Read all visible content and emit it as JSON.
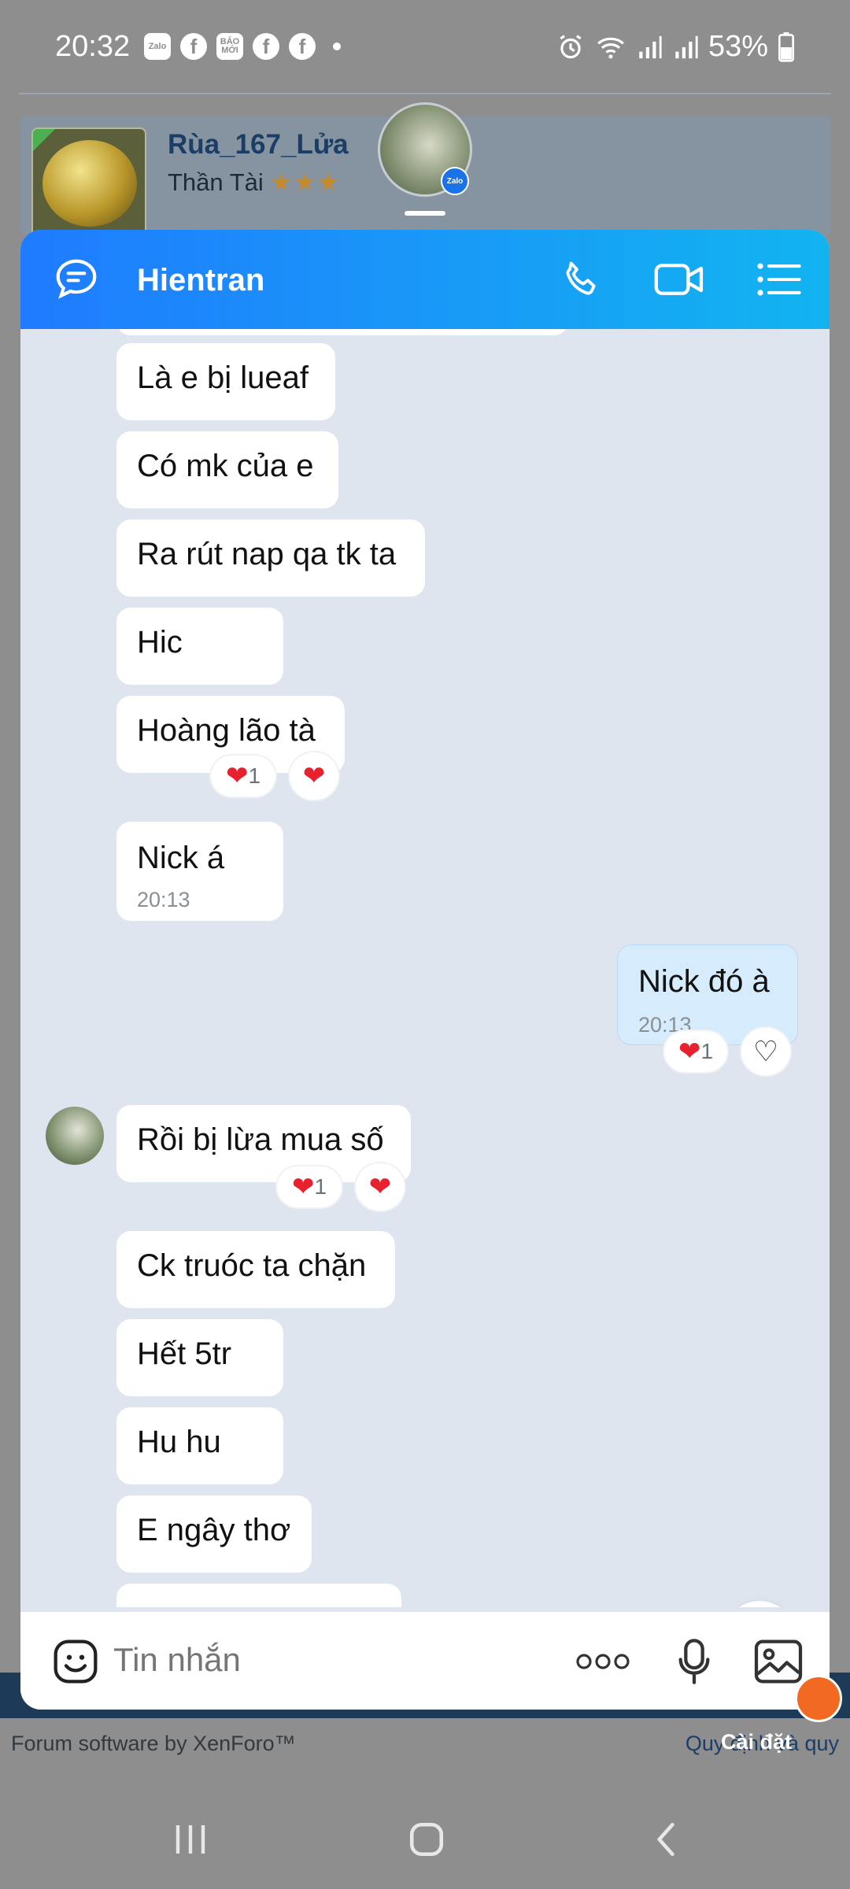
{
  "status_bar": {
    "time": "20:32",
    "app_icons": [
      "Zalo",
      "f",
      "BÁO MỚI",
      "f",
      "f"
    ],
    "battery": "53%"
  },
  "background_page": {
    "username": "Rùa_167_Lửa",
    "user_title": "Thần Tài",
    "user_stars": "★★★",
    "bubble_badge": "Zalo",
    "footer_left": "Forum software by XenForo™",
    "footer_right": "Quy định và quy",
    "footer_button": "Cài đặt"
  },
  "chat": {
    "contact_name": "Hientran",
    "messages": [
      {
        "text": "Là e bị lueaf"
      },
      {
        "text": "Có mk của e"
      },
      {
        "text": "Ra rút nap qa tk ta"
      },
      {
        "text": "Hic"
      },
      {
        "text": "Hoàng lão tà",
        "reaction_count": "1"
      },
      {
        "text": "Nick á",
        "time": "20:13"
      },
      {
        "text": "Nick đó à",
        "time": "20:13",
        "reaction_count": "1",
        "outgoing": true
      },
      {
        "text": "Rồi bị lừa mua số",
        "reaction_count": "1"
      },
      {
        "text": "Ck truóc ta chặn"
      },
      {
        "text": "Hết 5tr"
      },
      {
        "text": "Hu hu"
      },
      {
        "text": "E ngây thơ"
      }
    ],
    "input_placeholder": "Tin nhắn"
  },
  "colors": {
    "header_start": "#1f7bff",
    "header_end": "#12b4f0",
    "outgoing_bubble": "#d6ecfc",
    "chat_background": "#dfe5ee"
  }
}
